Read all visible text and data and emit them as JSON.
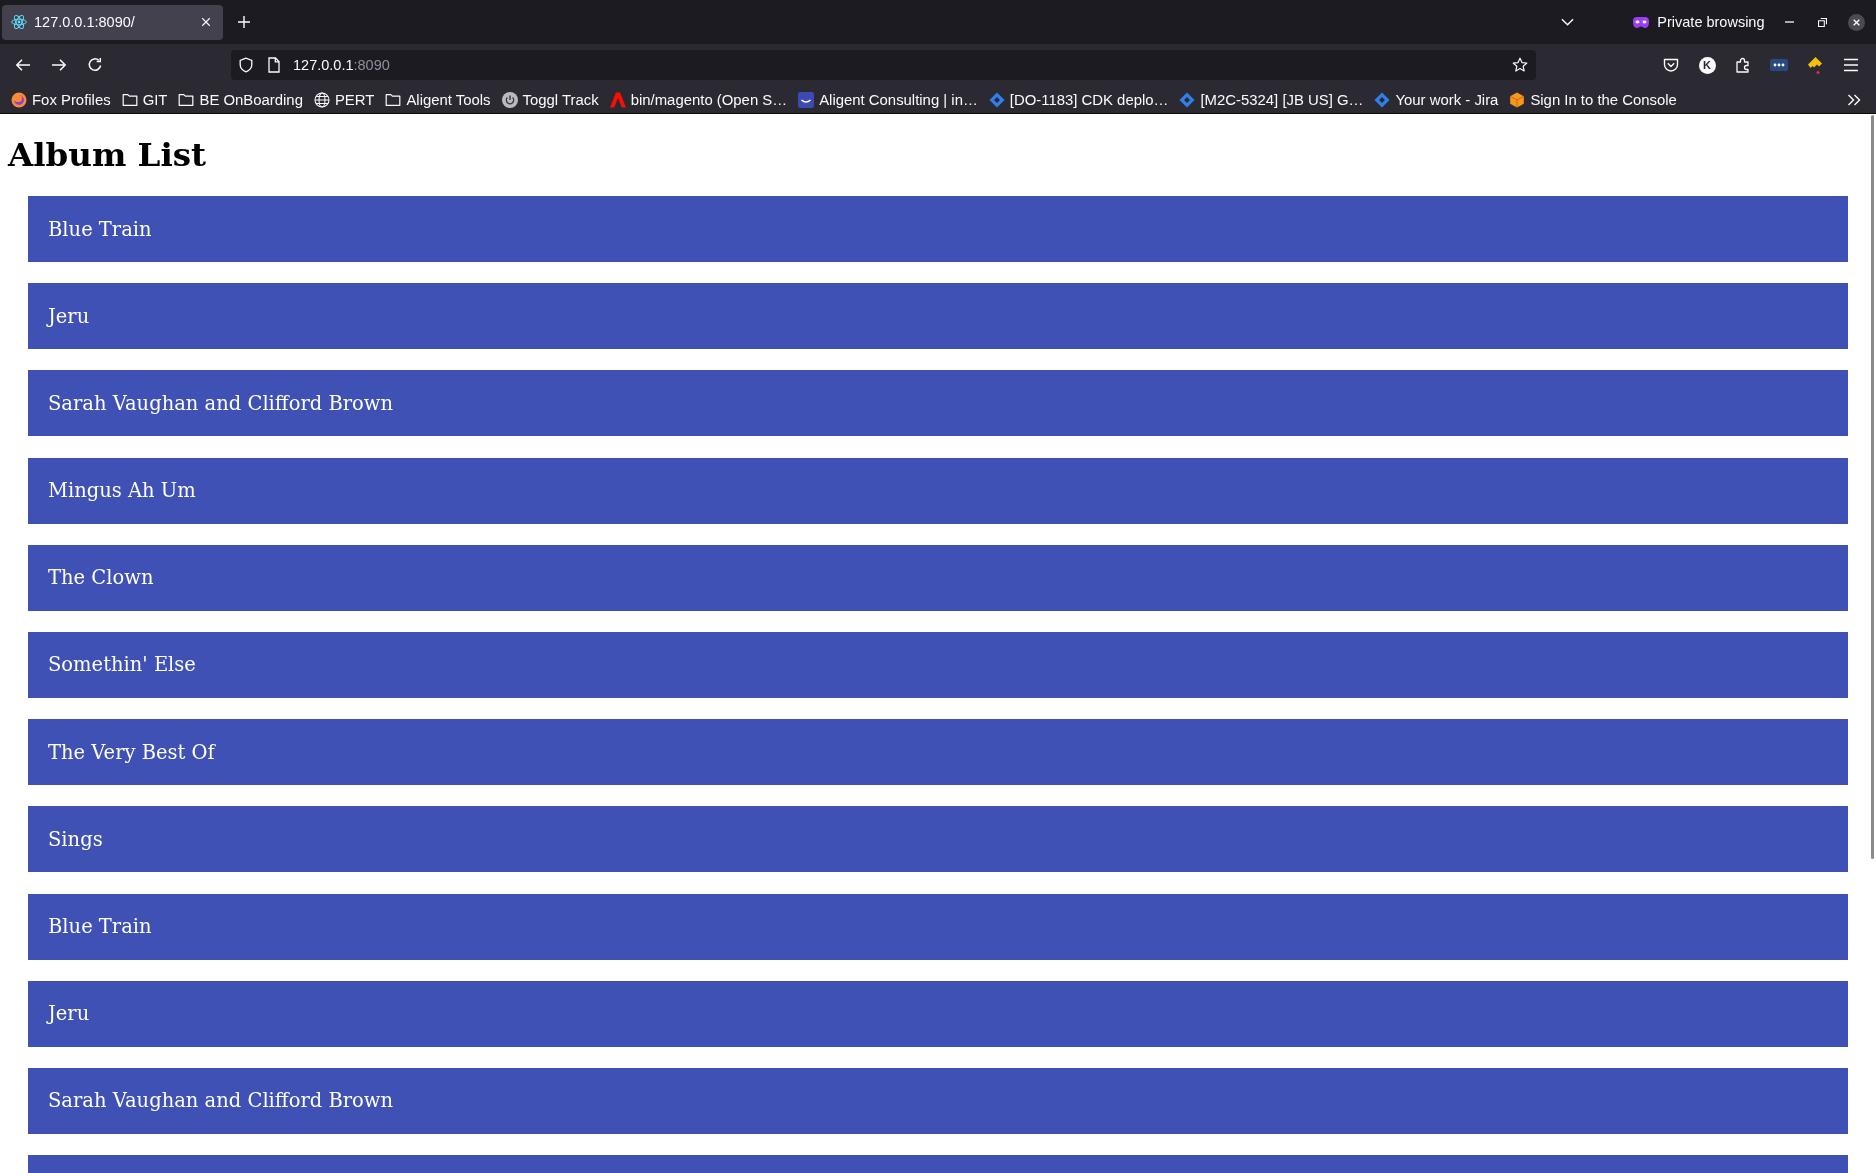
{
  "browser": {
    "tab": {
      "title": "127.0.0.1:8090/",
      "selected": true
    },
    "private_label": "Private browsing",
    "address": {
      "host": "127.0.0.1",
      "port": ":8090"
    },
    "extension_letter": "K",
    "bookmarks": [
      {
        "label": "Fox Profiles",
        "kind": "fox"
      },
      {
        "label": "GIT",
        "kind": "folder"
      },
      {
        "label": "BE OnBoarding",
        "kind": "folder"
      },
      {
        "label": "PERT",
        "kind": "globe"
      },
      {
        "label": "Aligent Tools",
        "kind": "folder"
      },
      {
        "label": "Toggl Track",
        "kind": "power"
      },
      {
        "label": "bin/magento (Open S…",
        "kind": "triangle"
      },
      {
        "label": "Aligent Consulting | in…",
        "kind": "smile"
      },
      {
        "label": "[DO-1183] CDK deplo…",
        "kind": "diamond"
      },
      {
        "label": "[M2C-5324] [JB US] G…",
        "kind": "diamond"
      },
      {
        "label": "Your work - Jira",
        "kind": "diamond"
      },
      {
        "label": "Sign In to the Console",
        "kind": "cube"
      }
    ]
  },
  "page": {
    "heading": "Album List",
    "albums": [
      {
        "title": "Blue Train",
        "kind": "full"
      },
      {
        "title": "Jeru",
        "kind": "full"
      },
      {
        "title": "Sarah Vaughan and Clifford Brown",
        "kind": "full"
      },
      {
        "title": "Mingus Ah Um",
        "kind": "full"
      },
      {
        "title": "The Clown",
        "kind": "full"
      },
      {
        "title": "Somethin' Else",
        "kind": "full"
      },
      {
        "title": "The Very Best Of",
        "kind": "full"
      },
      {
        "title": "Sings",
        "kind": "full"
      },
      {
        "title": "Blue Train",
        "kind": "full"
      },
      {
        "title": "Jeru",
        "kind": "full"
      },
      {
        "title": "Sarah Vaughan and Clifford Brown",
        "kind": "full"
      },
      {
        "kind": "cut-off"
      }
    ]
  }
}
